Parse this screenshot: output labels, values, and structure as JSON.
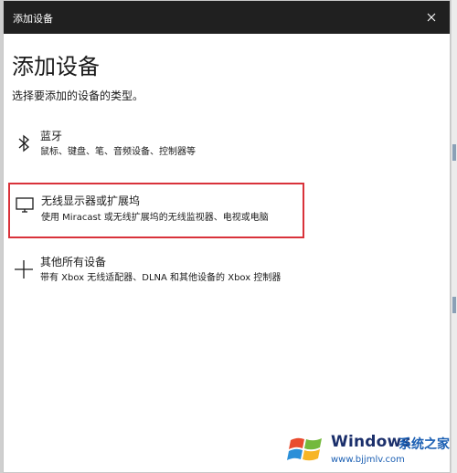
{
  "window": {
    "title": "添加设备",
    "close_icon": "close-icon"
  },
  "main": {
    "heading": "添加设备",
    "subtitle": "选择要添加的设备的类型。"
  },
  "options": [
    {
      "icon": "bluetooth-icon",
      "title": "蓝牙",
      "description": "鼠标、键盘、笔、音频设备、控制器等"
    },
    {
      "icon": "monitor-icon",
      "title": "无线显示器或扩展坞",
      "description": "使用 Miracast 或无线扩展坞的无线监视器、电视或电脑",
      "highlight_color": "#d9323a"
    },
    {
      "icon": "plus-icon",
      "title": "其他所有设备",
      "description": "带有 Xbox 无线适配器、DLNA 和其他设备的 Xbox 控制器"
    }
  ],
  "watermark": {
    "brand": "Windows",
    "brand_cn": "系统之家",
    "url": "www.bjjmlv.com",
    "logo_icon": "windows-logo-icon"
  }
}
